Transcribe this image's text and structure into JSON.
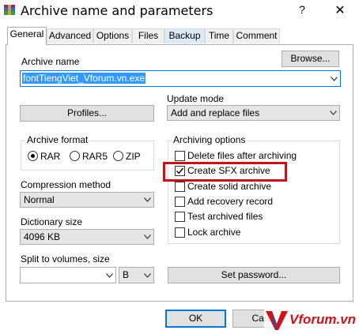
{
  "window": {
    "title": "Archive name and parameters",
    "help_glyph": "?",
    "close_glyph": "✕"
  },
  "tabs": [
    {
      "label": "General",
      "active": true
    },
    {
      "label": "Advanced"
    },
    {
      "label": "Options"
    },
    {
      "label": "Files"
    },
    {
      "label": "Backup"
    },
    {
      "label": "Time"
    },
    {
      "label": "Comment"
    }
  ],
  "archive_name": {
    "label": "Archive name",
    "value": "fontTiengViet_Vforum.vn.exe",
    "browse_label": "Browse..."
  },
  "profiles_label": "Profiles...",
  "update_mode": {
    "label": "Update mode",
    "value": "Add and replace files"
  },
  "archive_format": {
    "label": "Archive format",
    "options": [
      "RAR",
      "RAR5",
      "ZIP"
    ],
    "selected": "RAR"
  },
  "archiving_options": {
    "label": "Archiving options",
    "items": [
      {
        "label": "Delete files after archiving",
        "checked": false
      },
      {
        "label": "Create SFX archive",
        "checked": true
      },
      {
        "label": "Create solid archive",
        "checked": false
      },
      {
        "label": "Add recovery record",
        "checked": false
      },
      {
        "label": "Test archived files",
        "checked": false
      },
      {
        "label": "Lock archive",
        "checked": false
      }
    ]
  },
  "compression_method": {
    "label": "Compression method",
    "value": "Normal"
  },
  "dictionary_size": {
    "label": "Dictionary size",
    "value": "4096 KB"
  },
  "split_volumes": {
    "label": "Split to volumes, size",
    "value": "",
    "unit": "B"
  },
  "set_password_label": "Set password...",
  "footer": {
    "ok_label": "OK",
    "cancel_label": "Canc"
  },
  "watermark": {
    "text": "Vforum.vn",
    "colors": {
      "red": "#d0121b",
      "blue": "#1e5aa8"
    }
  },
  "colors": {
    "selection": "#3399ff",
    "highlight_box": "#c0151b",
    "focus": "#0078d7"
  }
}
